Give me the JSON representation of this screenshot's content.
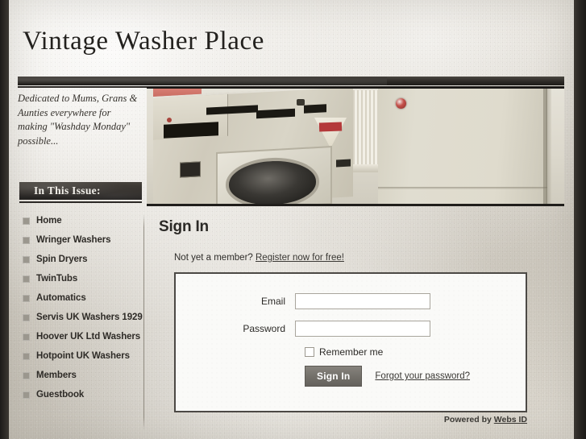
{
  "site": {
    "title": "Vintage Washer Place",
    "tagline": "Dedicated to Mums, Grans & Aunties everywhere for making \"Washday Monday\" possible...",
    "banner_alt": "vintage-washing-machines-photo"
  },
  "sidebar": {
    "heading": "In This Issue:",
    "items": [
      {
        "label": "Home",
        "icon": "square-bullet-icon"
      },
      {
        "label": "Wringer Washers",
        "icon": "square-bullet-icon"
      },
      {
        "label": "Spin Dryers",
        "icon": "square-bullet-icon"
      },
      {
        "label": "TwinTubs",
        "icon": "square-bullet-icon"
      },
      {
        "label": "Automatics",
        "icon": "square-bullet-icon"
      },
      {
        "label": "Servis UK Washers 1929",
        "icon": "square-bullet-icon"
      },
      {
        "label": "Hoover UK Ltd Washers",
        "icon": "square-bullet-icon"
      },
      {
        "label": "Hotpoint UK Washers",
        "icon": "square-bullet-icon"
      },
      {
        "label": "Members",
        "icon": "square-bullet-icon"
      },
      {
        "label": "Guestbook",
        "icon": "square-bullet-icon"
      }
    ]
  },
  "main": {
    "page_title": "Sign In",
    "member_prompt_text": "Not yet a member?",
    "register_link": "Register now for free!",
    "form": {
      "email_label": "Email",
      "email_value": "",
      "email_placeholder": "",
      "password_label": "Password",
      "password_value": "",
      "password_placeholder": "",
      "remember_label": "Remember me",
      "remember_checked": false,
      "submit_label": "Sign In",
      "forgot_link": "Forgot your password?"
    }
  },
  "footer": {
    "powered_by_text": "Powered by ",
    "powered_by_link": "Webs ID"
  },
  "colors": {
    "paper": "#e3dfd7",
    "frame_dark": "#262320",
    "bar_dark": "#322e2a",
    "text": "#2e2b27",
    "bullet": "#9b978e",
    "button": "#726f69",
    "panel": "#fafaf8"
  }
}
